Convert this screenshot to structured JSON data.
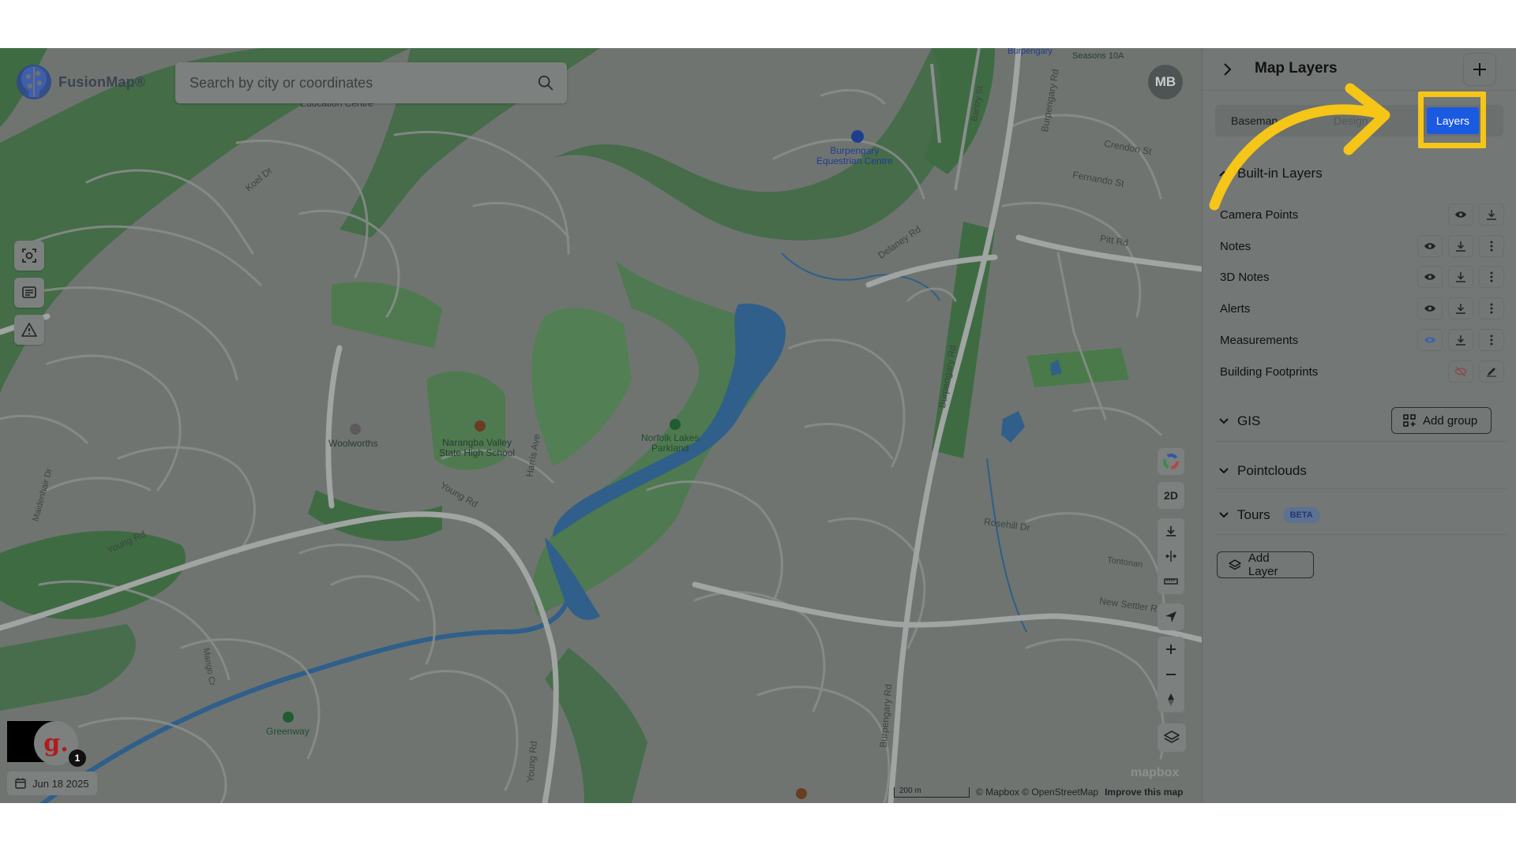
{
  "app": {
    "name": "FusionMap®"
  },
  "search": {
    "placeholder": "Search by city or coordinates"
  },
  "user": {
    "initials": "MB"
  },
  "left_tools": [
    {
      "name": "screenshot-icon"
    },
    {
      "name": "notes-icon"
    },
    {
      "name": "alert-icon"
    }
  ],
  "right_tools": {
    "view_mode_label": "2D"
  },
  "profile": {
    "letter": "g.",
    "notification_count": "1"
  },
  "date": {
    "label": "Jun 18 2025"
  },
  "attribution": {
    "scale_label": "200 m",
    "text": "© Mapbox © OpenStreetMap",
    "improve_link": "Improve this map",
    "brand": "mapbox"
  },
  "map_labels": {
    "education": "Education Centre",
    "seasons": "Seasons 10A",
    "burpengary_east": "Burpengary",
    "equestrian": "Burpengary\nEquestrian Centre",
    "crendon": "Crendon St",
    "fernando": "Fernando St",
    "pitt": "Pitt Rd",
    "delaney": "Delaney Rd",
    "koel": "Koel Dr",
    "woolworths": "Woolworths",
    "school": "Narangba Valley\nState High School",
    "norfolk": "Norfolk Lakes\nParkland",
    "harris": "Harris Ave",
    "young1": "Young Rd",
    "young2": "Young Rd",
    "young3": "Young Rd",
    "burp_rd1": "Burpengary Rd",
    "burp_rd2": "Burpengary Rd",
    "burp_rd3": "Burpengary Rd",
    "rosehill": "Rosehill Dr",
    "tontonan": "Tontonan",
    "new_settler": "New Settler Rd",
    "greenway": "Greenway",
    "mango": "Mango Cr",
    "maidenhair": "Maidenhair Dr",
    "bantry": "Bantry St"
  },
  "panel": {
    "title": "Map Layers",
    "tabs": [
      "Basemap",
      "Design",
      "Layers"
    ],
    "active_tab": "Layers",
    "built_in": {
      "title": "Built-in Layers",
      "layers": [
        {
          "name": "Camera Points"
        },
        {
          "name": "Notes"
        },
        {
          "name": "3D Notes"
        },
        {
          "name": "Alerts"
        },
        {
          "name": "Measurements"
        },
        {
          "name": "Building Footprints"
        }
      ]
    },
    "gis": {
      "title": "GIS",
      "add_group_label": "Add group"
    },
    "pointclouds": {
      "title": "Pointclouds"
    },
    "tours": {
      "title": "Tours",
      "badge": "BETA"
    },
    "add_layer_label": "Add Layer"
  },
  "colors": {
    "accent": "#1a5ae0",
    "highlight": "#f5c518",
    "overlay": "#737776"
  }
}
